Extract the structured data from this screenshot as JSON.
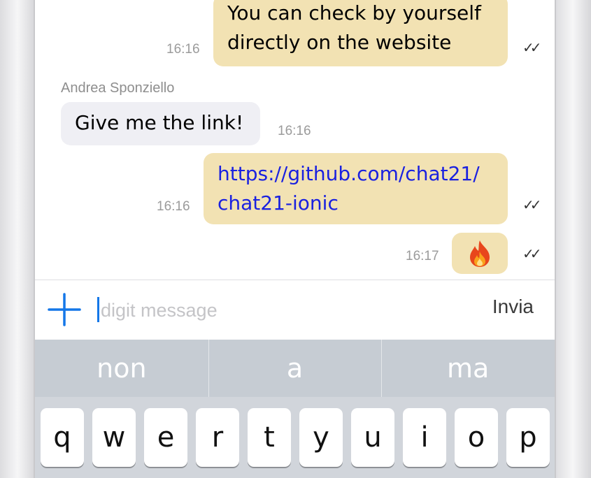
{
  "messages": [
    {
      "direction": "out",
      "lines": [
        "You can check by yourself",
        "directly on the website"
      ],
      "time": "16:16",
      "status": "read-check-icon"
    },
    {
      "direction": "in",
      "sender": "Andrea Sponziello",
      "lines": [
        "Give me the link!"
      ],
      "time": "16:16"
    },
    {
      "direction": "out",
      "lines": [
        "https://github.com/chat21/",
        "chat21-ionic"
      ],
      "time": "16:16",
      "status": "read-check-icon",
      "link_color": "#1a21e0"
    },
    {
      "direction": "out",
      "emoji": "fire-icon",
      "time": "16:17",
      "status": "read-check-icon"
    }
  ],
  "input": {
    "placeholder": "digit message",
    "value": "",
    "send_label": "Invia",
    "add_icon": "plus-icon"
  },
  "suggestions": [
    "non",
    "a",
    "ma"
  ],
  "keyboard": {
    "row1": [
      "q",
      "w",
      "e",
      "r",
      "t",
      "y",
      "u",
      "i",
      "o",
      "p"
    ]
  },
  "colors": {
    "outgoing_bubble": "#f2e2b3",
    "incoming_bubble": "#efeff4",
    "accent": "#1477e8",
    "suggestion_bar": "#c6ccd3"
  }
}
